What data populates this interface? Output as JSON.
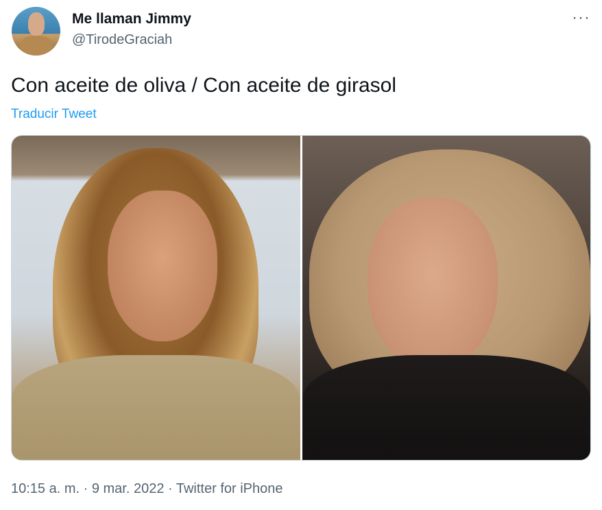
{
  "author": {
    "name": "Me llaman Jimmy",
    "handle": "@TirodeGraciah"
  },
  "more_icon": "more-horizontal-icon",
  "more_glyph": "···",
  "tweet": {
    "text": "Con aceite de oliva / Con aceite de girasol",
    "translate_label": "Traducir Tweet"
  },
  "media": {
    "count": 2
  },
  "meta": {
    "timestamp_line": "10:15 a. m. · 9 mar. 2022 · Twitter for iPhone"
  },
  "colors": {
    "link": "#1d9bf0",
    "secondary": "#536471",
    "primary_text": "#0f1419",
    "border": "#cfd9de"
  }
}
